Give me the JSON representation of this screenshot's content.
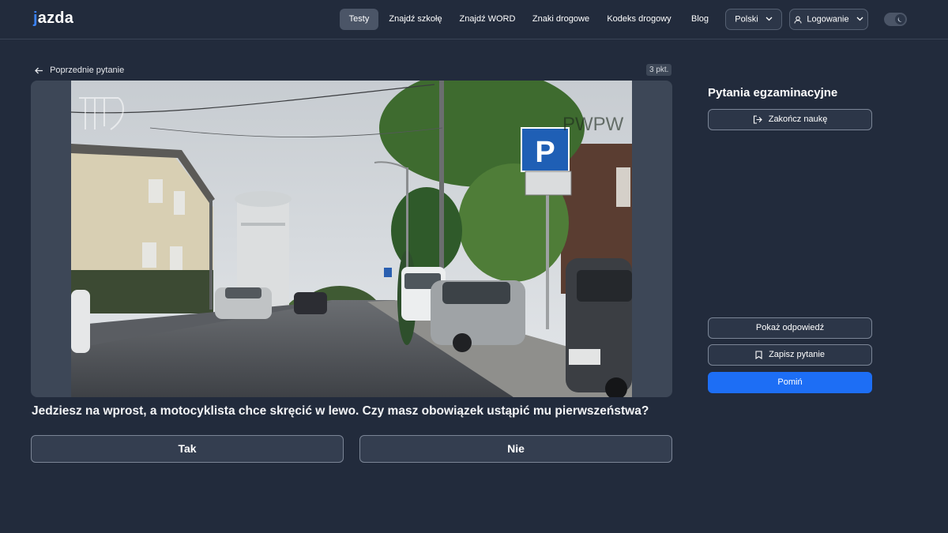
{
  "header": {
    "logo": "jazda",
    "nav": [
      "Testy",
      "Znajdź szkołę",
      "Znajdź WORD",
      "Znaki drogowe",
      "Kodeks drogowy",
      "Blog"
    ],
    "active_nav": "Testy",
    "language": "Polski",
    "login": "Logowanie",
    "theme_icon": "moon-icon"
  },
  "question": {
    "prev_label": "Poprzednie pytanie",
    "points": "3 pkt.",
    "watermark_right": "PWPW",
    "text": "Jedziesz na wprost, a motocyklista chce skręcić w lewo. Czy masz obowiązek ustąpić mu pierwszeństwa?",
    "answers": [
      "Tak",
      "Nie"
    ]
  },
  "sidebar": {
    "title": "Pytania egzaminacyjne",
    "end_button": "Zakończ naukę",
    "show_answer": "Pokaż odpowiedź",
    "save_question": "Zapisz pytanie",
    "skip": "Pomiń"
  },
  "colors": {
    "background": "#222b3c",
    "accent": "#1d6ef5",
    "logo_accent": "#3b82f6"
  }
}
